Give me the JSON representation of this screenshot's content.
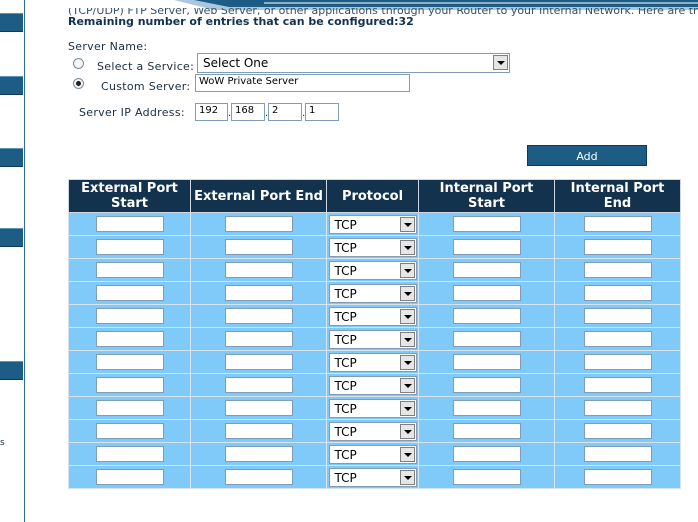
{
  "header": {
    "top_line": "(TCP/UDP) FTP Server, Web Server, or other applications through your Router to your Internal Network. Here are the",
    "remaining": "Remaining number of entries that can be configured:32"
  },
  "form": {
    "server_name_label": "Server Name:",
    "select_service_label": "Select a Service:",
    "select_service_value": "Select One",
    "custom_server_label": "Custom Server:",
    "custom_server_value": "WoW Private Server",
    "server_ip_label": "Server IP Address:",
    "ip": [
      "192",
      "168",
      "2",
      "1"
    ],
    "ip_separator": "."
  },
  "add_button": "Add",
  "table": {
    "headers": [
      "External Port Start",
      "External Port End",
      "Protocol",
      "Internal Port Start",
      "Internal Port End"
    ],
    "protocol_value": "TCP",
    "row_count": 12
  },
  "left_nav": {
    "partial_text": "s"
  },
  "colors": {
    "nav_blue": "#1d5c85",
    "header_dark": "#13324d",
    "table_cell": "#7fcaf8"
  }
}
